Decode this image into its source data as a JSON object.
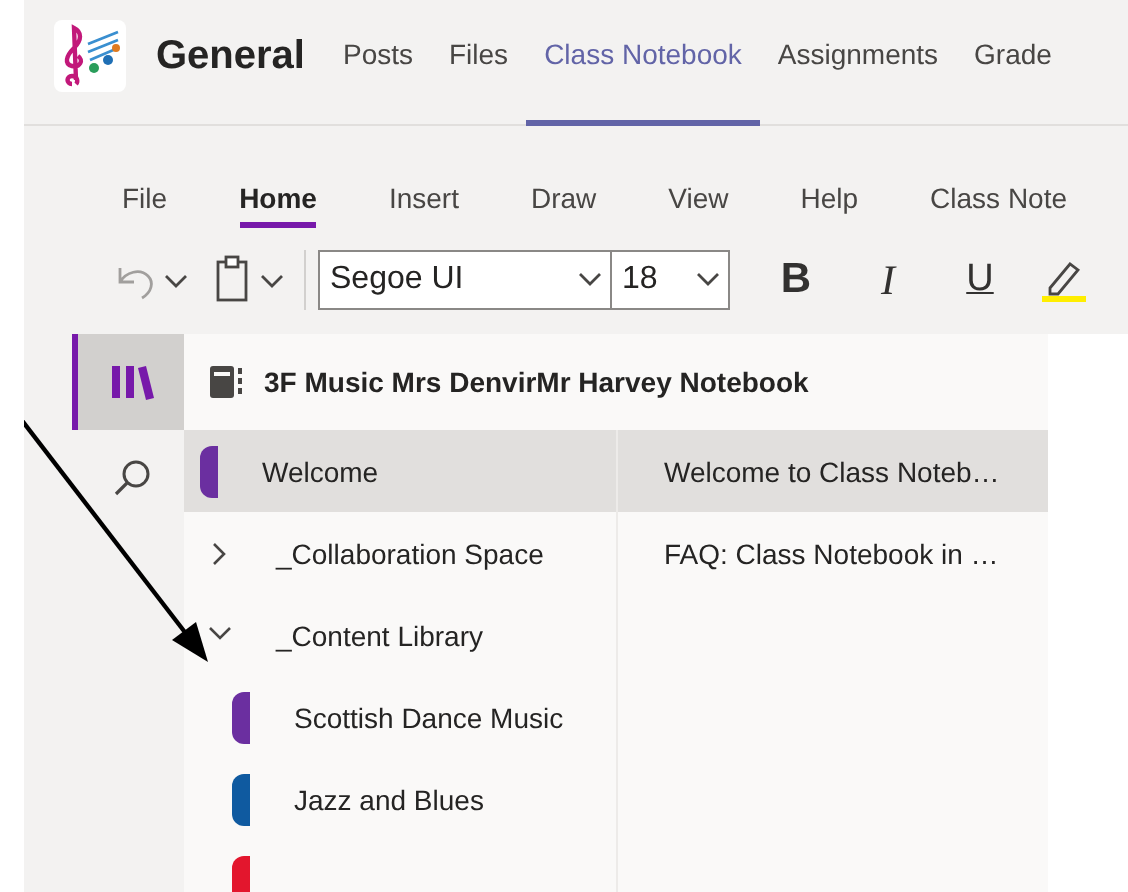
{
  "header": {
    "team": "General",
    "tabs": [
      {
        "label": "Posts",
        "selected": false
      },
      {
        "label": "Files",
        "selected": false
      },
      {
        "label": "Class Notebook",
        "selected": true
      },
      {
        "label": "Assignments",
        "selected": false
      },
      {
        "label": "Grade",
        "selected": false
      }
    ]
  },
  "ribbon": {
    "tabs": [
      {
        "label": "File",
        "selected": false
      },
      {
        "label": "Home",
        "selected": true
      },
      {
        "label": "Insert",
        "selected": false
      },
      {
        "label": "Draw",
        "selected": false
      },
      {
        "label": "View",
        "selected": false
      },
      {
        "label": "Help",
        "selected": false
      },
      {
        "label": "Class Note",
        "selected": false
      }
    ],
    "font": "Segoe UI",
    "font_size": "18",
    "format_buttons": [
      "B",
      "I",
      "U"
    ]
  },
  "rail": [
    {
      "kind": "notebooks",
      "selected": true
    },
    {
      "kind": "search",
      "selected": false
    }
  ],
  "notebook": {
    "title": "3F Music Mrs DenvirMr Harvey Notebook"
  },
  "sections": [
    {
      "kind": "section",
      "name": "Welcome",
      "color": "#6b2fa0",
      "selected": true
    },
    {
      "kind": "group",
      "name": "_Collaboration Space",
      "expanded": false,
      "selected": false
    },
    {
      "kind": "group",
      "name": "_Content Library",
      "expanded": true,
      "selected": false,
      "children": [
        {
          "kind": "section",
          "name": "Scottish Dance Music",
          "color": "#6b2fa0",
          "selected": false
        },
        {
          "kind": "section",
          "name": "Jazz and Blues",
          "color": "#0f5aa0",
          "selected": false
        },
        {
          "kind": "section",
          "color": "#e3162d",
          "selected": false
        }
      ]
    }
  ],
  "pages": [
    {
      "title": "Welcome to Class Noteb…",
      "selected": true
    },
    {
      "title": "FAQ: Class Notebook in …",
      "selected": false
    }
  ]
}
